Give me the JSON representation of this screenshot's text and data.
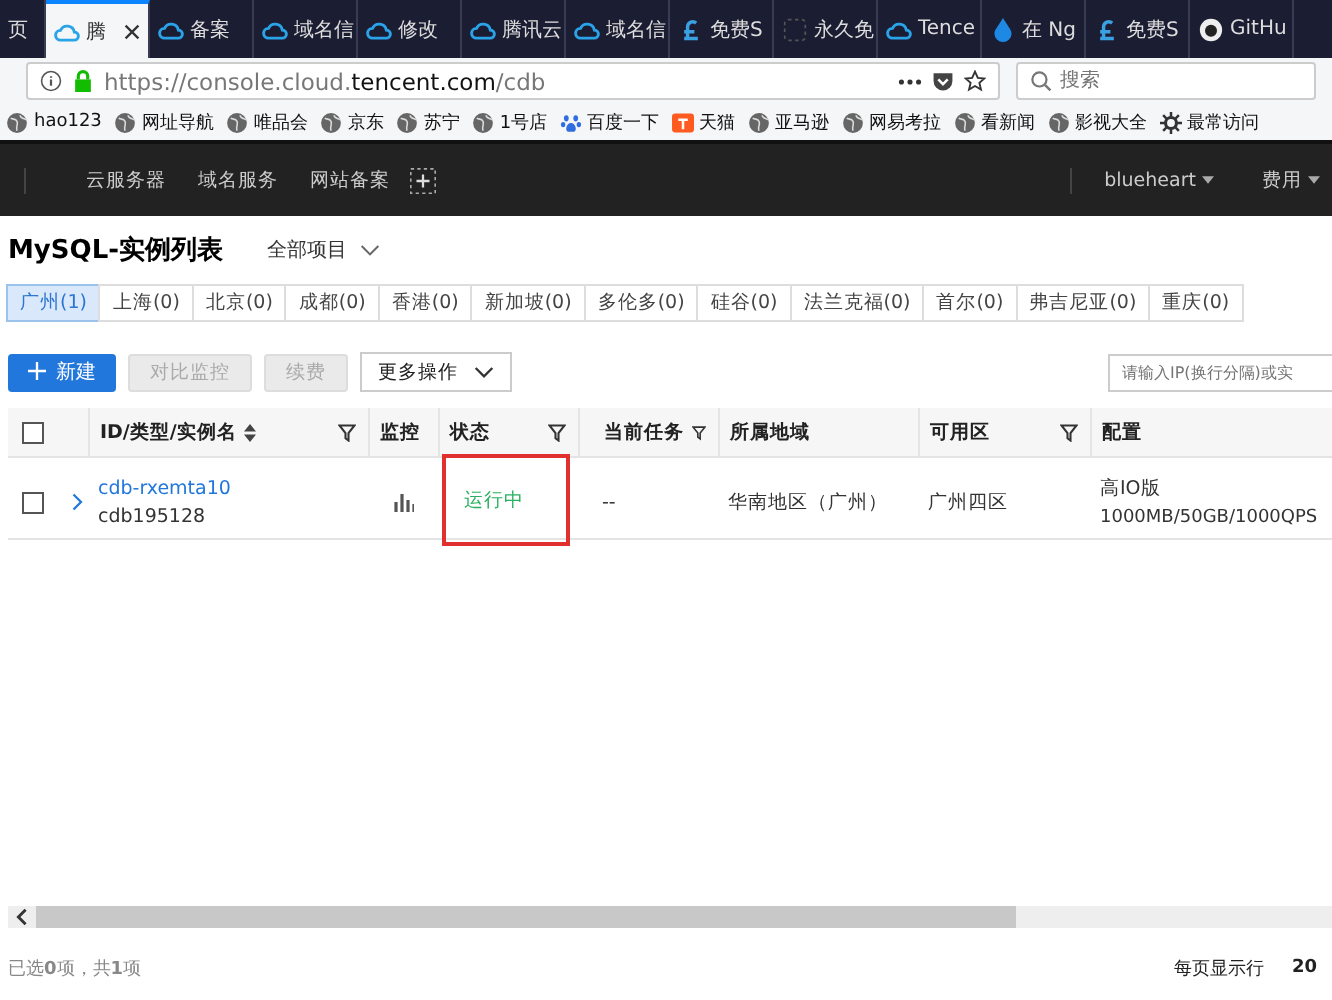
{
  "browser_tabs": [
    {
      "title": "页",
      "selected": false
    },
    {
      "title": "腾",
      "selected": true
    },
    {
      "title": "备案",
      "selected": false
    },
    {
      "title": "域名信",
      "selected": false
    },
    {
      "title": "修改",
      "selected": false
    },
    {
      "title": "腾讯云",
      "selected": false
    },
    {
      "title": "域名信",
      "selected": false
    },
    {
      "title": "免费S",
      "selected": false
    },
    {
      "title": "永久免",
      "selected": false
    },
    {
      "title": "Tence",
      "selected": false
    },
    {
      "title": "在 Ng",
      "selected": false
    },
    {
      "title": "免费S",
      "selected": false
    },
    {
      "title": "GitHu",
      "selected": false
    }
  ],
  "address_bar": {
    "url_prefix": "https://console.cloud.",
    "url_domain": "tencent.com",
    "url_path": "/cdb"
  },
  "search": {
    "placeholder": "搜索"
  },
  "bookmarks": [
    "hao123",
    "网址导航",
    "唯品会",
    "京东",
    "苏宁",
    "1号店",
    "百度一下",
    "天猫",
    "亚马逊",
    "网易考拉",
    "看新闻",
    "影视大全",
    "最常访问"
  ],
  "console_nav": {
    "items": [
      "云服务器",
      "域名服务",
      "网站备案"
    ],
    "user": "blueheart",
    "billing": "费用"
  },
  "page": {
    "title": "MySQL-实例列表",
    "project": "全部项目",
    "regions": [
      {
        "label": "广州(1)",
        "selected": true
      },
      {
        "label": "上海(0)",
        "selected": false
      },
      {
        "label": "北京(0)",
        "selected": false
      },
      {
        "label": "成都(0)",
        "selected": false
      },
      {
        "label": "香港(0)",
        "selected": false
      },
      {
        "label": "新加坡(0)",
        "selected": false
      },
      {
        "label": "多伦多(0)",
        "selected": false
      },
      {
        "label": "硅谷(0)",
        "selected": false
      },
      {
        "label": "法兰克福(0)",
        "selected": false
      },
      {
        "label": "首尔(0)",
        "selected": false
      },
      {
        "label": "弗吉尼亚(0)",
        "selected": false
      },
      {
        "label": "重庆(0)",
        "selected": false
      }
    ],
    "toolbar": {
      "new_button": "新建",
      "buttons": [
        {
          "label": "对比监控",
          "disabled": true
        },
        {
          "label": "续费",
          "disabled": true
        }
      ],
      "more": "更多操作",
      "search_placeholder": "请输入IP(换行分隔)或实"
    }
  },
  "table": {
    "select_all_checked": false,
    "columns": [
      "ID/类型/实例名",
      "监控",
      "状态",
      "当前任务",
      "所属地域",
      "可用区",
      "配置"
    ],
    "rows": [
      {
        "checked": false,
        "id": "cdb-rxemta10",
        "name": "cdb195128",
        "status": "运行中",
        "highlighted": true,
        "task": "--",
        "region": "华南地区（广州）",
        "zone": "广州四区",
        "config_type": "高IO版",
        "config_spec": "1000MB/50GB/1000QPS"
      }
    ]
  },
  "footer": {
    "summary": "已选**0**项，共**1**项",
    "per_page_label": "每页显示行",
    "per_page": "20"
  }
}
